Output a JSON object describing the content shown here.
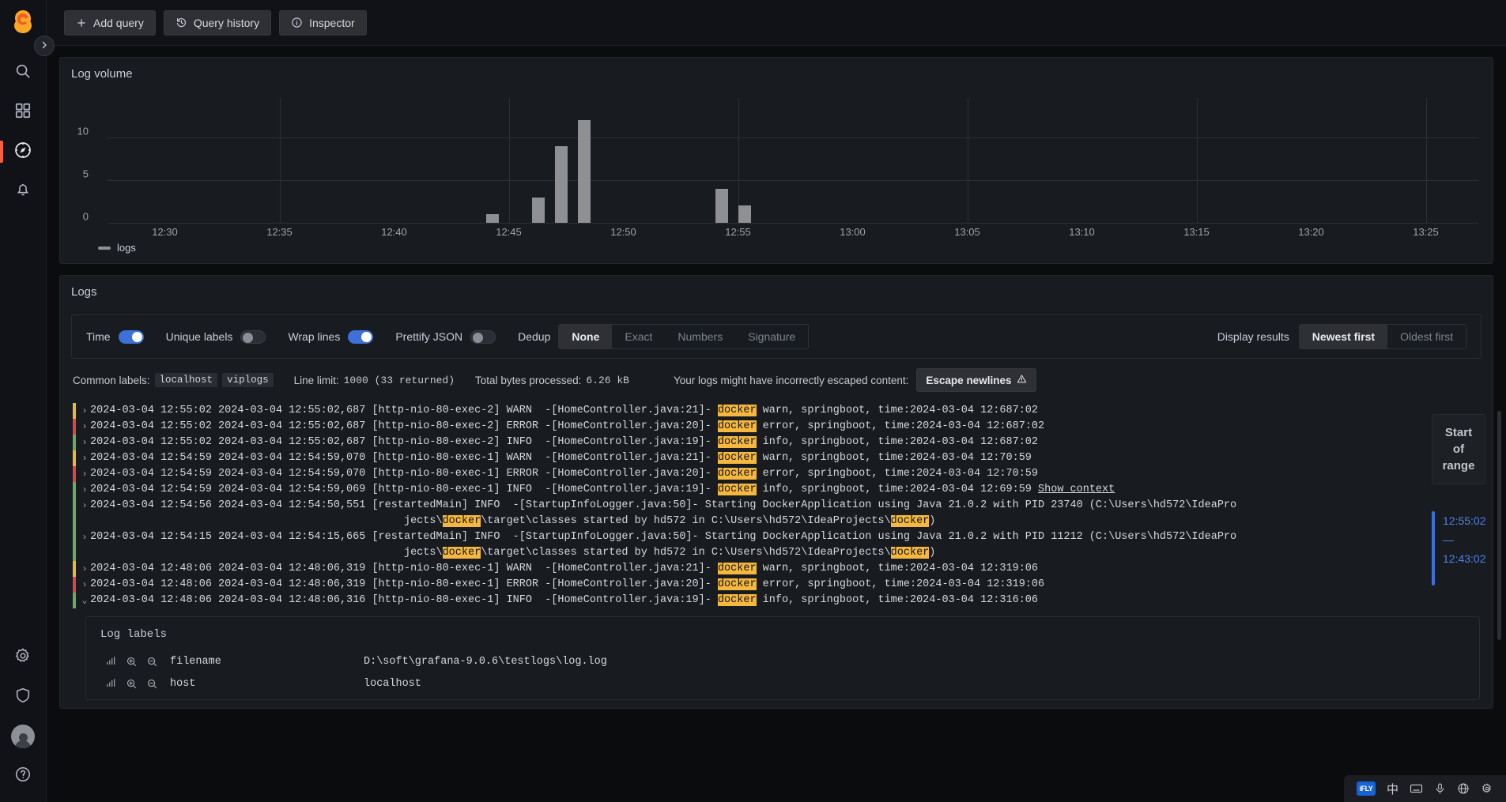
{
  "nav": {
    "logo_icon": "grafana-logo-icon",
    "toggle_icon": "chevron-right-icon",
    "items": [
      {
        "name": "search",
        "icon": "search-icon"
      },
      {
        "name": "dashboards",
        "icon": "grid-icon"
      },
      {
        "name": "explore",
        "icon": "compass-icon",
        "active": true
      },
      {
        "name": "alerting",
        "icon": "bell-icon"
      }
    ],
    "bottom_items": [
      {
        "name": "configuration",
        "icon": "gear-icon"
      },
      {
        "name": "server-admin",
        "icon": "shield-icon"
      },
      {
        "name": "user-profile",
        "icon": "avatar-icon"
      },
      {
        "name": "help",
        "icon": "question-circle-icon"
      }
    ]
  },
  "toolbar": {
    "add_query": "Add query",
    "query_history": "Query history",
    "inspector": "Inspector",
    "add_icon": "plus-icon",
    "history_icon": "history-icon",
    "inspector_icon": "info-circle-icon"
  },
  "volume_panel": {
    "title": "Log volume"
  },
  "chart_data": {
    "type": "bar",
    "title": "Log volume",
    "xlabel": "",
    "ylabel": "",
    "ylim": [
      0,
      12
    ],
    "yticks": [
      0,
      5,
      10
    ],
    "grid": true,
    "legend_position": "bottom-left",
    "series": [
      {
        "name": "logs",
        "color": "#8e9094",
        "categories": [
          "12:44",
          "12:46",
          "12:47",
          "12:48",
          "12:54",
          "12:55"
        ],
        "values": [
          1,
          3,
          9,
          12,
          4,
          2
        ]
      }
    ],
    "xtick_labels": [
      "12:30",
      "12:35",
      "12:40",
      "12:45",
      "12:50",
      "12:55",
      "13:00",
      "13:05",
      "13:10",
      "13:15",
      "13:20",
      "13:25"
    ],
    "legend": [
      "logs"
    ]
  },
  "logs_panel": {
    "title": "Logs"
  },
  "controls": {
    "time_label": "Time",
    "time_on": true,
    "unique_labels_label": "Unique labels",
    "unique_labels_on": false,
    "wrap_lines_label": "Wrap lines",
    "wrap_lines_on": true,
    "prettify_label": "Prettify JSON",
    "prettify_on": false,
    "dedup_label": "Dedup",
    "dedup_options": [
      "None",
      "Exact",
      "Numbers",
      "Signature"
    ],
    "dedup_selected": "None",
    "display_results_label": "Display results",
    "order_options": [
      "Newest first",
      "Oldest first"
    ],
    "order_selected": "Newest first"
  },
  "meta": {
    "common_labels_label": "Common labels:",
    "common_labels": [
      "localhost",
      "viplogs"
    ],
    "line_limit_label": "Line limit:",
    "line_limit_value": "1000 (33 returned)",
    "bytes_label": "Total bytes processed:",
    "bytes_value": "6.26 kB",
    "escape_notice": "Your logs might have incorrectly escaped content:",
    "escape_button": "Escape newlines",
    "escape_icon": "warning-triangle-icon"
  },
  "log_rows": [
    {
      "sev": "warn",
      "caret": "collapsed",
      "text": "2024-03-04 12:55:02 2024-03-04 12:55:02,687 [http-nio-80-exec-2] WARN  -[HomeController.java:21]- ",
      "hl": "docker",
      "after": " warn, springboot, time:2024-03-04 12:687:02"
    },
    {
      "sev": "error",
      "caret": "collapsed",
      "text": "2024-03-04 12:55:02 2024-03-04 12:55:02,687 [http-nio-80-exec-2] ERROR -[HomeController.java:20]- ",
      "hl": "docker",
      "after": " error, springboot, time:2024-03-04 12:687:02"
    },
    {
      "sev": "info",
      "caret": "collapsed",
      "text": "2024-03-04 12:55:02 2024-03-04 12:55:02,687 [http-nio-80-exec-2] INFO  -[HomeController.java:19]- ",
      "hl": "docker",
      "after": " info, springboot, time:2024-03-04 12:687:02"
    },
    {
      "sev": "warn",
      "caret": "collapsed",
      "text": "2024-03-04 12:54:59 2024-03-04 12:54:59,070 [http-nio-80-exec-1] WARN  -[HomeController.java:21]- ",
      "hl": "docker",
      "after": " warn, springboot, time:2024-03-04 12:70:59"
    },
    {
      "sev": "error",
      "caret": "collapsed",
      "text": "2024-03-04 12:54:59 2024-03-04 12:54:59,070 [http-nio-80-exec-1] ERROR -[HomeController.java:20]- ",
      "hl": "docker",
      "after": " error, springboot, time:2024-03-04 12:70:59"
    },
    {
      "sev": "info",
      "caret": "collapsed",
      "text": "2024-03-04 12:54:59 2024-03-04 12:54:59,069 [http-nio-80-exec-1] INFO  -[HomeController.java:19]- ",
      "hl": "docker",
      "after": " info, springboot, time:2024-03-04 12:69:59 ",
      "link": "Show context"
    },
    {
      "sev": "info",
      "caret": "collapsed",
      "text": "2024-03-04 12:54:56 2024-03-04 12:54:50,551 [restartedMain] INFO  -[StartupInfoLogger.java:50]- Starting DockerApplication using Java 21.0.2 with PID 23740 (C:\\Users\\hd572\\IdeaPro\n                                                 jects\\",
      "hl": "docker",
      "after": "\\target\\classes started by hd572 in C:\\Users\\hd572\\IdeaProjects\\",
      "hl2": "docker",
      "after2": ")"
    },
    {
      "sev": "info",
      "caret": "collapsed",
      "text": "2024-03-04 12:54:15 2024-03-04 12:54:15,665 [restartedMain] INFO  -[StartupInfoLogger.java:50]- Starting DockerApplication using Java 21.0.2 with PID 11212 (C:\\Users\\hd572\\IdeaPro\n                                                 jects\\",
      "hl": "docker",
      "after": "\\target\\classes started by hd572 in C:\\Users\\hd572\\IdeaProjects\\",
      "hl2": "docker",
      "after2": ")"
    },
    {
      "sev": "warn",
      "caret": "collapsed",
      "text": "2024-03-04 12:48:06 2024-03-04 12:48:06,319 [http-nio-80-exec-1] WARN  -[HomeController.java:21]- ",
      "hl": "docker",
      "after": " warn, springboot, time:2024-03-04 12:319:06"
    },
    {
      "sev": "error",
      "caret": "collapsed",
      "text": "2024-03-04 12:48:06 2024-03-04 12:48:06,319 [http-nio-80-exec-1] ERROR -[HomeController.java:20]- ",
      "hl": "docker",
      "after": " error, springboot, time:2024-03-04 12:319:06"
    },
    {
      "sev": "info",
      "caret": "expanded",
      "text": "2024-03-04 12:48:06 2024-03-04 12:48:06,316 [http-nio-80-exec-1] INFO  -[HomeController.java:19]- ",
      "hl": "docker",
      "after": " info, springboot, time:2024-03-04 12:316:06"
    }
  ],
  "log_labels": {
    "title": "Log labels",
    "rows": [
      {
        "key": "filename",
        "value": "D:\\soft\\grafana-9.0.6\\testlogs\\log.log"
      },
      {
        "key": "host",
        "value": "localhost"
      }
    ],
    "stats_icon": "bar-stats-icon",
    "filter_for_icon": "zoom-in-icon",
    "filter_out_icon": "zoom-out-icon"
  },
  "range": {
    "start_of_range": "Start\nof\nrange",
    "start_of_range_l1": "Start",
    "start_of_range_l2": "of",
    "start_of_range_l3": "range",
    "time_top": "12:55:02",
    "time_dash": "—",
    "time_bottom": "12:43:02"
  },
  "taskbar": {
    "ime_logo": "iFLY",
    "lang": "中",
    "items": [
      "keyboard-icon",
      "microphone-icon",
      "globe-icon",
      "settings-icon"
    ]
  },
  "colors": {
    "accent": "#3d71d9",
    "warn": "#eab839",
    "error": "#e0434a",
    "info": "#6aab5b",
    "highlight": "#f5b73d",
    "logo": "#f55f3e"
  }
}
